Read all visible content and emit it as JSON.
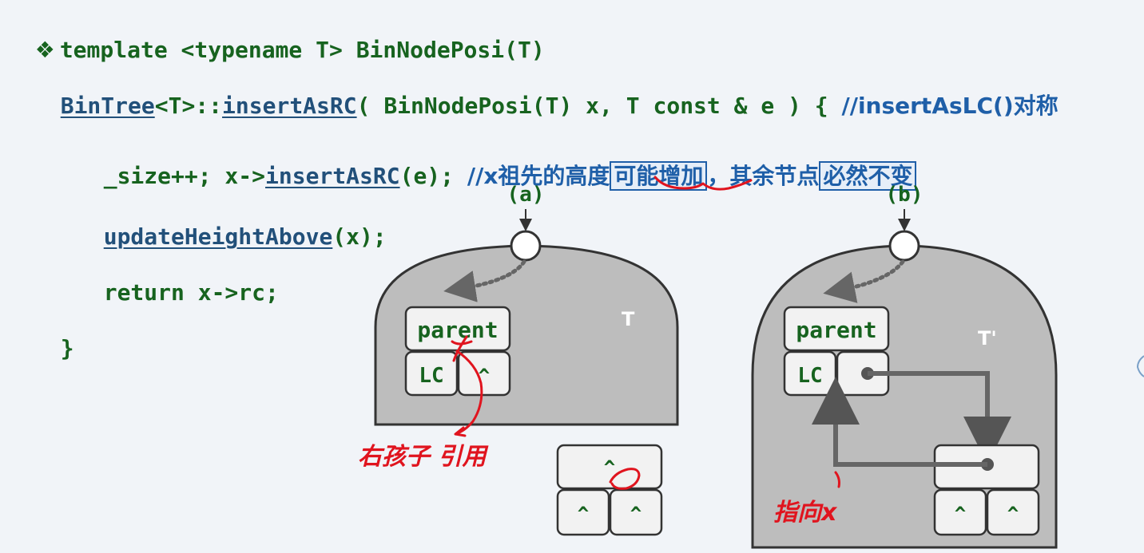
{
  "code": {
    "bullet": "❖",
    "line1": "template <typename T> BinNodePosi(T)",
    "line2_cls": "BinTree",
    "line2_a": "<T>::",
    "line2_fn": "insertAsRC",
    "line2_b": "( BinNodePosi(T) x, T const & e ) { ",
    "line2_comment": "//insertAsLC()对称",
    "line3_a": "_size++; x->",
    "line3_fn": "insertAsRC",
    "line3_b": "(e); ",
    "line3_comment_a": "//x祖先的高度",
    "line3_box1": "可能增加",
    "line3_comment_b": "，其余节点",
    "line3_box2": "必然不变",
    "line4_fn": "updateHeightAbove",
    "line4_b": "(x);",
    "line5": "return x->rc;",
    "line6": "}"
  },
  "diagram": {
    "label_a": "(a)",
    "label_b": "(b)",
    "tree_a": "T",
    "tree_b": "T'",
    "parent": "parent",
    "lc": "LC",
    "caret": "^"
  },
  "handwriting": {
    "note_a": "右孩子 引用",
    "note_b": "指向x"
  },
  "colors": {
    "code_green": "#17631f",
    "comment_blue": "#1f5fa8",
    "tree_gray": "#bdbdbd",
    "ink_red": "#e0141e"
  }
}
